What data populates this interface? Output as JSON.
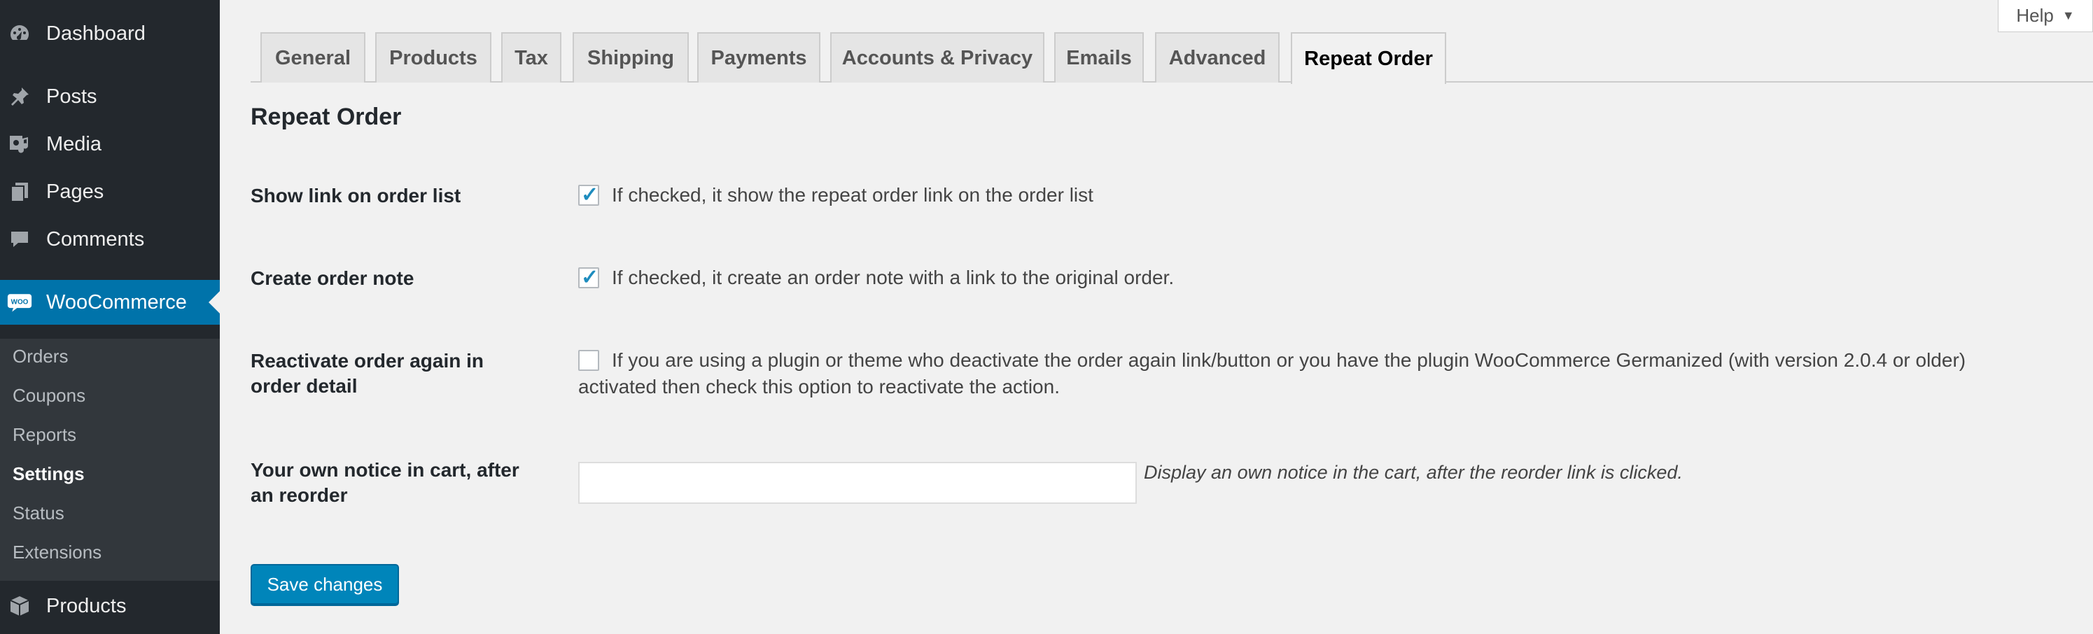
{
  "sidebar": {
    "items": [
      {
        "label": "Dashboard",
        "icon": "dashboard-icon"
      },
      {
        "label": "Posts",
        "icon": "pin-icon"
      },
      {
        "label": "Media",
        "icon": "media-icon"
      },
      {
        "label": "Pages",
        "icon": "pages-icon"
      },
      {
        "label": "Comments",
        "icon": "comment-icon"
      },
      {
        "label": "WooCommerce",
        "icon": "woo-icon",
        "logo_text": "WOO"
      },
      {
        "label": "Products",
        "icon": "box-icon"
      }
    ],
    "submenu": [
      "Orders",
      "Coupons",
      "Reports",
      "Settings",
      "Status",
      "Extensions"
    ],
    "current_submenu": "Settings",
    "accent_color": "#0073aa"
  },
  "help": {
    "label": "Help"
  },
  "tabs": [
    {
      "label": "General"
    },
    {
      "label": "Products"
    },
    {
      "label": "Tax"
    },
    {
      "label": "Shipping"
    },
    {
      "label": "Payments"
    },
    {
      "label": "Accounts & Privacy"
    },
    {
      "label": "Emails"
    },
    {
      "label": "Advanced"
    },
    {
      "label": "Repeat Order",
      "active": true
    }
  ],
  "page": {
    "heading": "Repeat Order"
  },
  "fields": {
    "show_link": {
      "label": "Show link on order list",
      "checked": true,
      "description": "If checked, it show the repeat order link on the order list"
    },
    "create_note": {
      "label": "Create order note",
      "checked": true,
      "description": "If checked, it create an order note with a link to the original order."
    },
    "reactivate": {
      "label_line1": "Reactivate order again in",
      "label_line2": "order detail",
      "checked": false,
      "description_line1": "If you are using a plugin or theme who deactivate the order again link/button or you have the plugin WooCommerce Germanized (with version 2.0.4 or older)",
      "description_line2": "activated then check this option to reactivate the action."
    },
    "notice": {
      "label_line1": "Your own notice in cart, after",
      "label_line2": "an reorder",
      "value": "",
      "description": "Display an own notice in the cart, after the reorder link is clicked."
    }
  },
  "actions": {
    "save_label": "Save changes"
  }
}
